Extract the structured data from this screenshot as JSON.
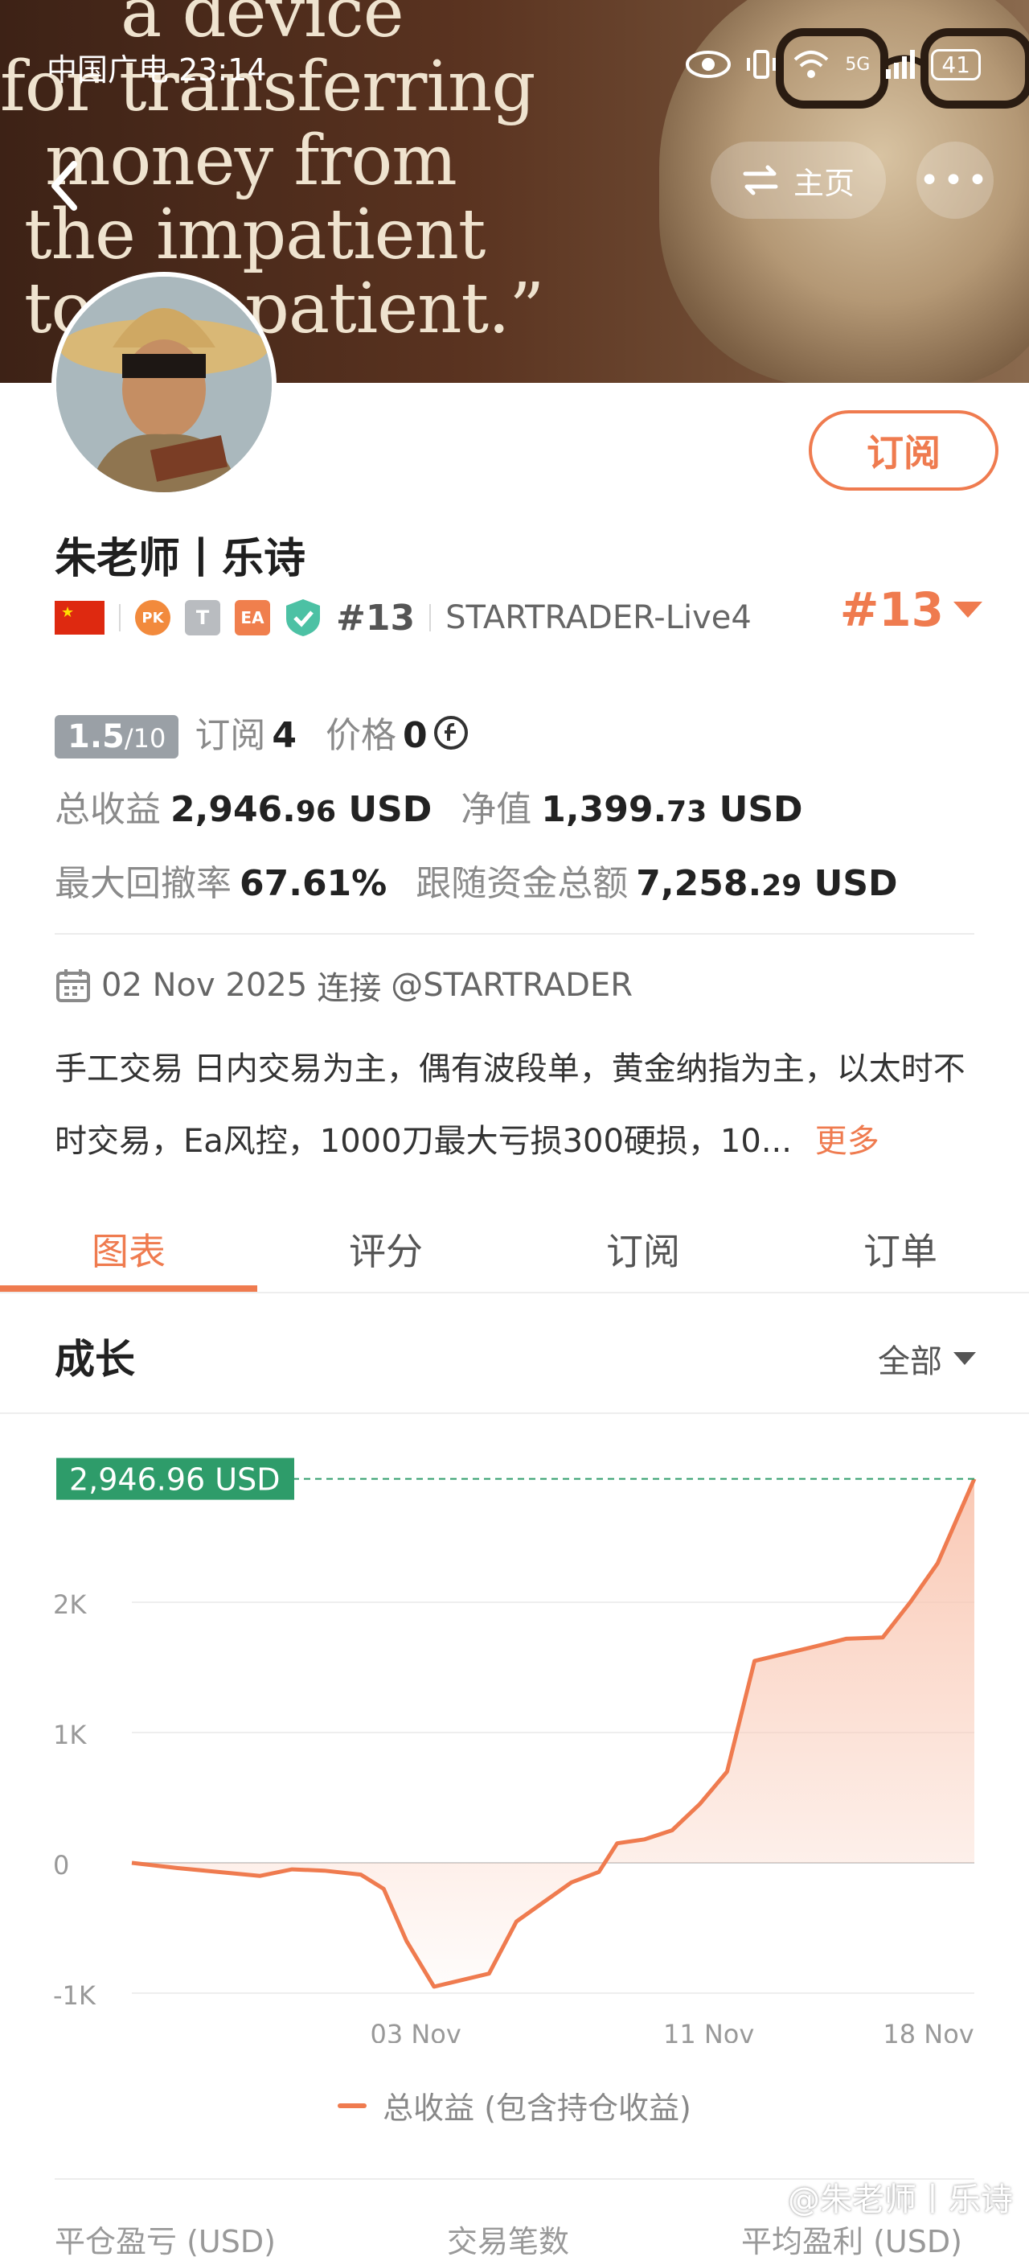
{
  "banner": {
    "quote_lines": [
      "a device",
      "for transferring",
      "money from",
      "the impatient",
      "to the patient.”"
    ]
  },
  "status_bar": {
    "carrier_time": "中国广电 23:14",
    "network": "5G",
    "battery": "41"
  },
  "header": {
    "home_label": "主页",
    "more_label": "•••"
  },
  "profile": {
    "name": "朱老师丨乐诗",
    "subscribe_label": "订阅",
    "badges": {
      "pk": "PK",
      "t": "T",
      "ea": "EA"
    },
    "rank_small": "#13",
    "server": "STARTRADER-Live4",
    "rank_big": "#13"
  },
  "metrics": {
    "score_main": "1.5",
    "score_total": "/10",
    "subscribe_label": "订阅",
    "subscribe_count": "4",
    "price_label": "价格",
    "price_value": "0",
    "total_profit_label": "总收益",
    "total_profit_int": "2,946.",
    "total_profit_dec": "96",
    "total_profit_unit": " USD",
    "equity_label": "净值",
    "equity_int": "1,399.",
    "equity_dec": "73",
    "equity_unit": " USD",
    "drawdown_label": "最大回撤率",
    "drawdown_value": "67.61%",
    "follow_label": "跟随资金总额",
    "follow_int": "7,258.",
    "follow_dec": "29",
    "follow_unit": " USD"
  },
  "info": {
    "date": "02 Nov 2025",
    "connect_label": "连接",
    "broker": "@STARTRADER",
    "description": "手工交易 日内交易为主，偶有波段单，黄金纳指为主，以太时不时交易，Ea风控，1000刀最大亏损300硬损，10...",
    "more_label": "更多"
  },
  "tabs": [
    "图表",
    "评分",
    "订阅",
    "订单"
  ],
  "growth": {
    "title": "成长",
    "filter_label": "全部"
  },
  "chart_data": {
    "type": "area",
    "y_ticks": [
      "2K",
      "1K",
      "0",
      "-1K"
    ],
    "x_ticks": [
      "03 Nov",
      "11 Nov",
      "18 Nov"
    ],
    "current_label": "2,946.96 USD",
    "current_value": 2946.96,
    "ylim": [
      -1000,
      2950
    ],
    "series": [
      {
        "name": "总收益 (包含持仓收益)",
        "points": [
          [
            0,
            0
          ],
          [
            1,
            -40
          ],
          [
            1.6,
            -60
          ],
          [
            2.2,
            -80
          ],
          [
            2.8,
            -100
          ],
          [
            3.5,
            -50
          ],
          [
            4.2,
            -60
          ],
          [
            5,
            -90
          ],
          [
            5.5,
            -200
          ],
          [
            6,
            -600
          ],
          [
            6.6,
            -950
          ],
          [
            7.2,
            -900
          ],
          [
            7.8,
            -850
          ],
          [
            8.4,
            -450
          ],
          [
            9,
            -300
          ],
          [
            9.6,
            -150
          ],
          [
            10.2,
            -70
          ],
          [
            10.6,
            150
          ],
          [
            11.2,
            180
          ],
          [
            11.8,
            250
          ],
          [
            12.4,
            450
          ],
          [
            13,
            700
          ],
          [
            13.6,
            1550
          ],
          [
            14.2,
            1600
          ],
          [
            14.8,
            1650
          ],
          [
            15.6,
            1720
          ],
          [
            16.4,
            1730
          ],
          [
            17,
            2000
          ],
          [
            17.6,
            2300
          ],
          [
            18.4,
            2946.96
          ]
        ],
        "color": "#ef7b4f"
      }
    ],
    "legend": "总收益 (包含持仓收益)",
    "colors": {
      "line": "#ef7b4f",
      "fill": "#f9c6b1",
      "current": "#2e9c6a",
      "grid": "#eeeeee"
    }
  },
  "stats_headers": [
    "平仓盈亏 (USD)",
    "交易笔数",
    "平均盈利 (USD)"
  ],
  "watermark": "@朱老师丨乐诗"
}
